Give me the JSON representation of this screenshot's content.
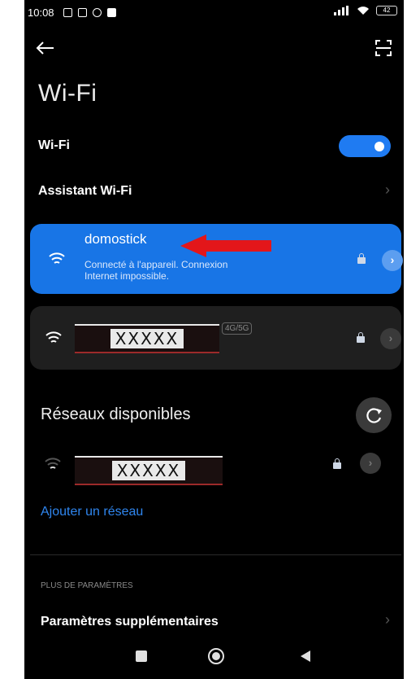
{
  "status_bar": {
    "time": "10:08",
    "battery": "42"
  },
  "header": {
    "title": "Wi-Fi"
  },
  "wifi_toggle": {
    "label": "Wi-Fi",
    "state": "on",
    "accent": "#1f7bf2"
  },
  "assistant": {
    "label": "Assistant Wi-Fi"
  },
  "connected_network": {
    "name": "domostick",
    "status_line1": "Connecté à l'appareil. Connexion",
    "status_line2": "Internet impossible.",
    "card_color": "#1875e6"
  },
  "saved_network": {
    "name_redacted": "XXXXX",
    "band": "4G/5G"
  },
  "available": {
    "heading": "Réseaux disponibles",
    "networks": [
      {
        "name_redacted": "XXXXX"
      }
    ],
    "add_network": "Ajouter un réseau"
  },
  "more_settings": {
    "section_label": "PLUS DE PARAMÈTRES",
    "item_label": "Paramètres supplémentaires"
  }
}
